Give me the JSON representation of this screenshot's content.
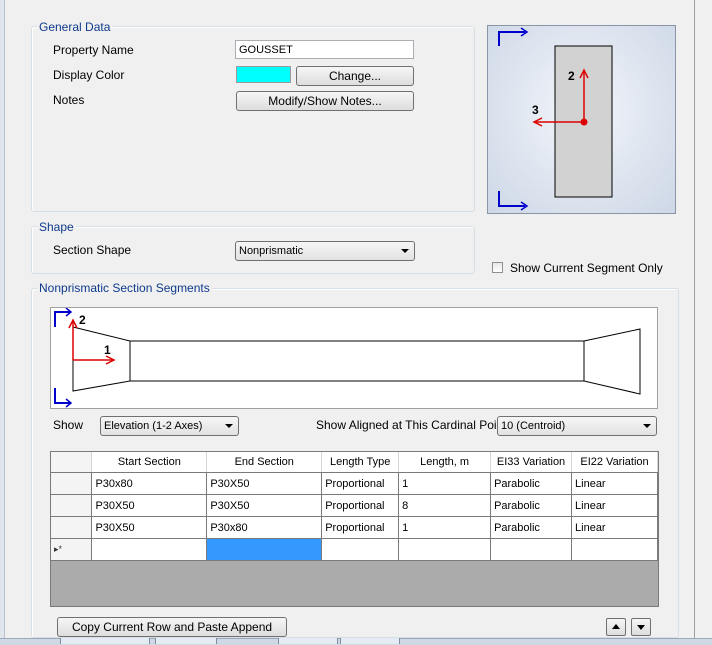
{
  "general": {
    "title": "General Data",
    "property_name_label": "Property Name",
    "property_name_value": "GOUSSET",
    "display_color_label": "Display Color",
    "display_color_value": "#00ffff",
    "change_button": "Change...",
    "notes_label": "Notes",
    "notes_button": "Modify/Show Notes..."
  },
  "preview": {
    "axis_vertical": "2",
    "axis_horizontal": "3"
  },
  "shape": {
    "title": "Shape",
    "section_shape_label": "Section Shape",
    "section_shape_value": "Nonprismatic"
  },
  "show_current_segment_only": {
    "label": "Show Current Segment Only",
    "checked": false
  },
  "segments": {
    "title": "Nonprismatic Section Segments",
    "elevation_axis_vertical": "2",
    "elevation_axis_horizontal": "1",
    "show_label": "Show",
    "show_value": "Elevation (1-2 Axes)",
    "cardinal_label": "Show Aligned at This Cardinal Point",
    "cardinal_value": "10  (Centroid)",
    "columns": [
      "Start Section",
      "End Section",
      "Length Type",
      "Length, m",
      "EI33 Variation",
      "EI22 Variation"
    ],
    "rows": [
      [
        "P30x80",
        "P30X50",
        "Proportional",
        "1",
        "Parabolic",
        "Linear"
      ],
      [
        "P30X50",
        "P30X50",
        "Proportional",
        "8",
        "Parabolic",
        "Linear"
      ],
      [
        "P30X50",
        "P30x80",
        "Proportional",
        "1",
        "Parabolic",
        "Linear"
      ]
    ],
    "new_row_marker": "▸*",
    "copy_button": "Copy Current Row and Paste Append"
  },
  "colors": {
    "group_title": "#0e3a8c",
    "axis_red": "#dd0000",
    "axis_blue": "#0000cc",
    "selection": "#3399ff"
  }
}
